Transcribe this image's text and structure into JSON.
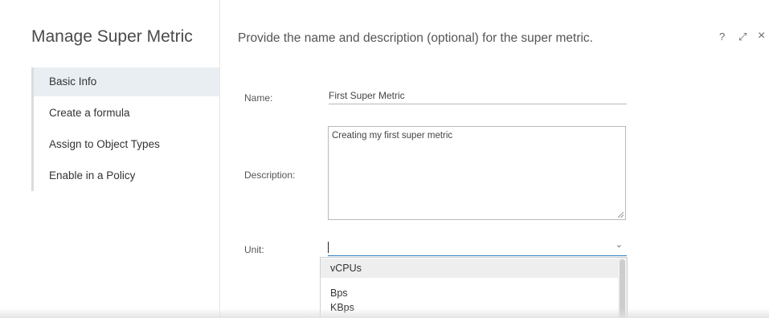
{
  "app": {
    "title": "Manage Super Metric"
  },
  "nav": {
    "items": [
      {
        "label": "Basic Info",
        "active": true
      },
      {
        "label": "Create a formula",
        "active": false
      },
      {
        "label": "Assign to Object Types",
        "active": false
      },
      {
        "label": "Enable in a Policy",
        "active": false
      }
    ]
  },
  "header": {
    "instruction": "Provide the name and description (optional) for the super metric.",
    "help_symbol": "?",
    "maximize_symbol": "⤢",
    "close_symbol": "×"
  },
  "form": {
    "name_label": "Name:",
    "name_value": "First Super Metric",
    "description_label": "Description:",
    "description_value": "Creating my first super metric",
    "unit_label": "Unit:",
    "unit_value": ""
  },
  "unit_dropdown": {
    "options": [
      "vCPUs",
      "",
      "Bps",
      "KBps"
    ],
    "highlighted": "vCPUs"
  },
  "colors": {
    "accent": "#2b7bb9",
    "nav_active_bg": "#e8eef2"
  },
  "icons": [
    "help-icon",
    "maximize-icon",
    "close-icon",
    "chevron-down-icon",
    "resize-grip-icon"
  ]
}
